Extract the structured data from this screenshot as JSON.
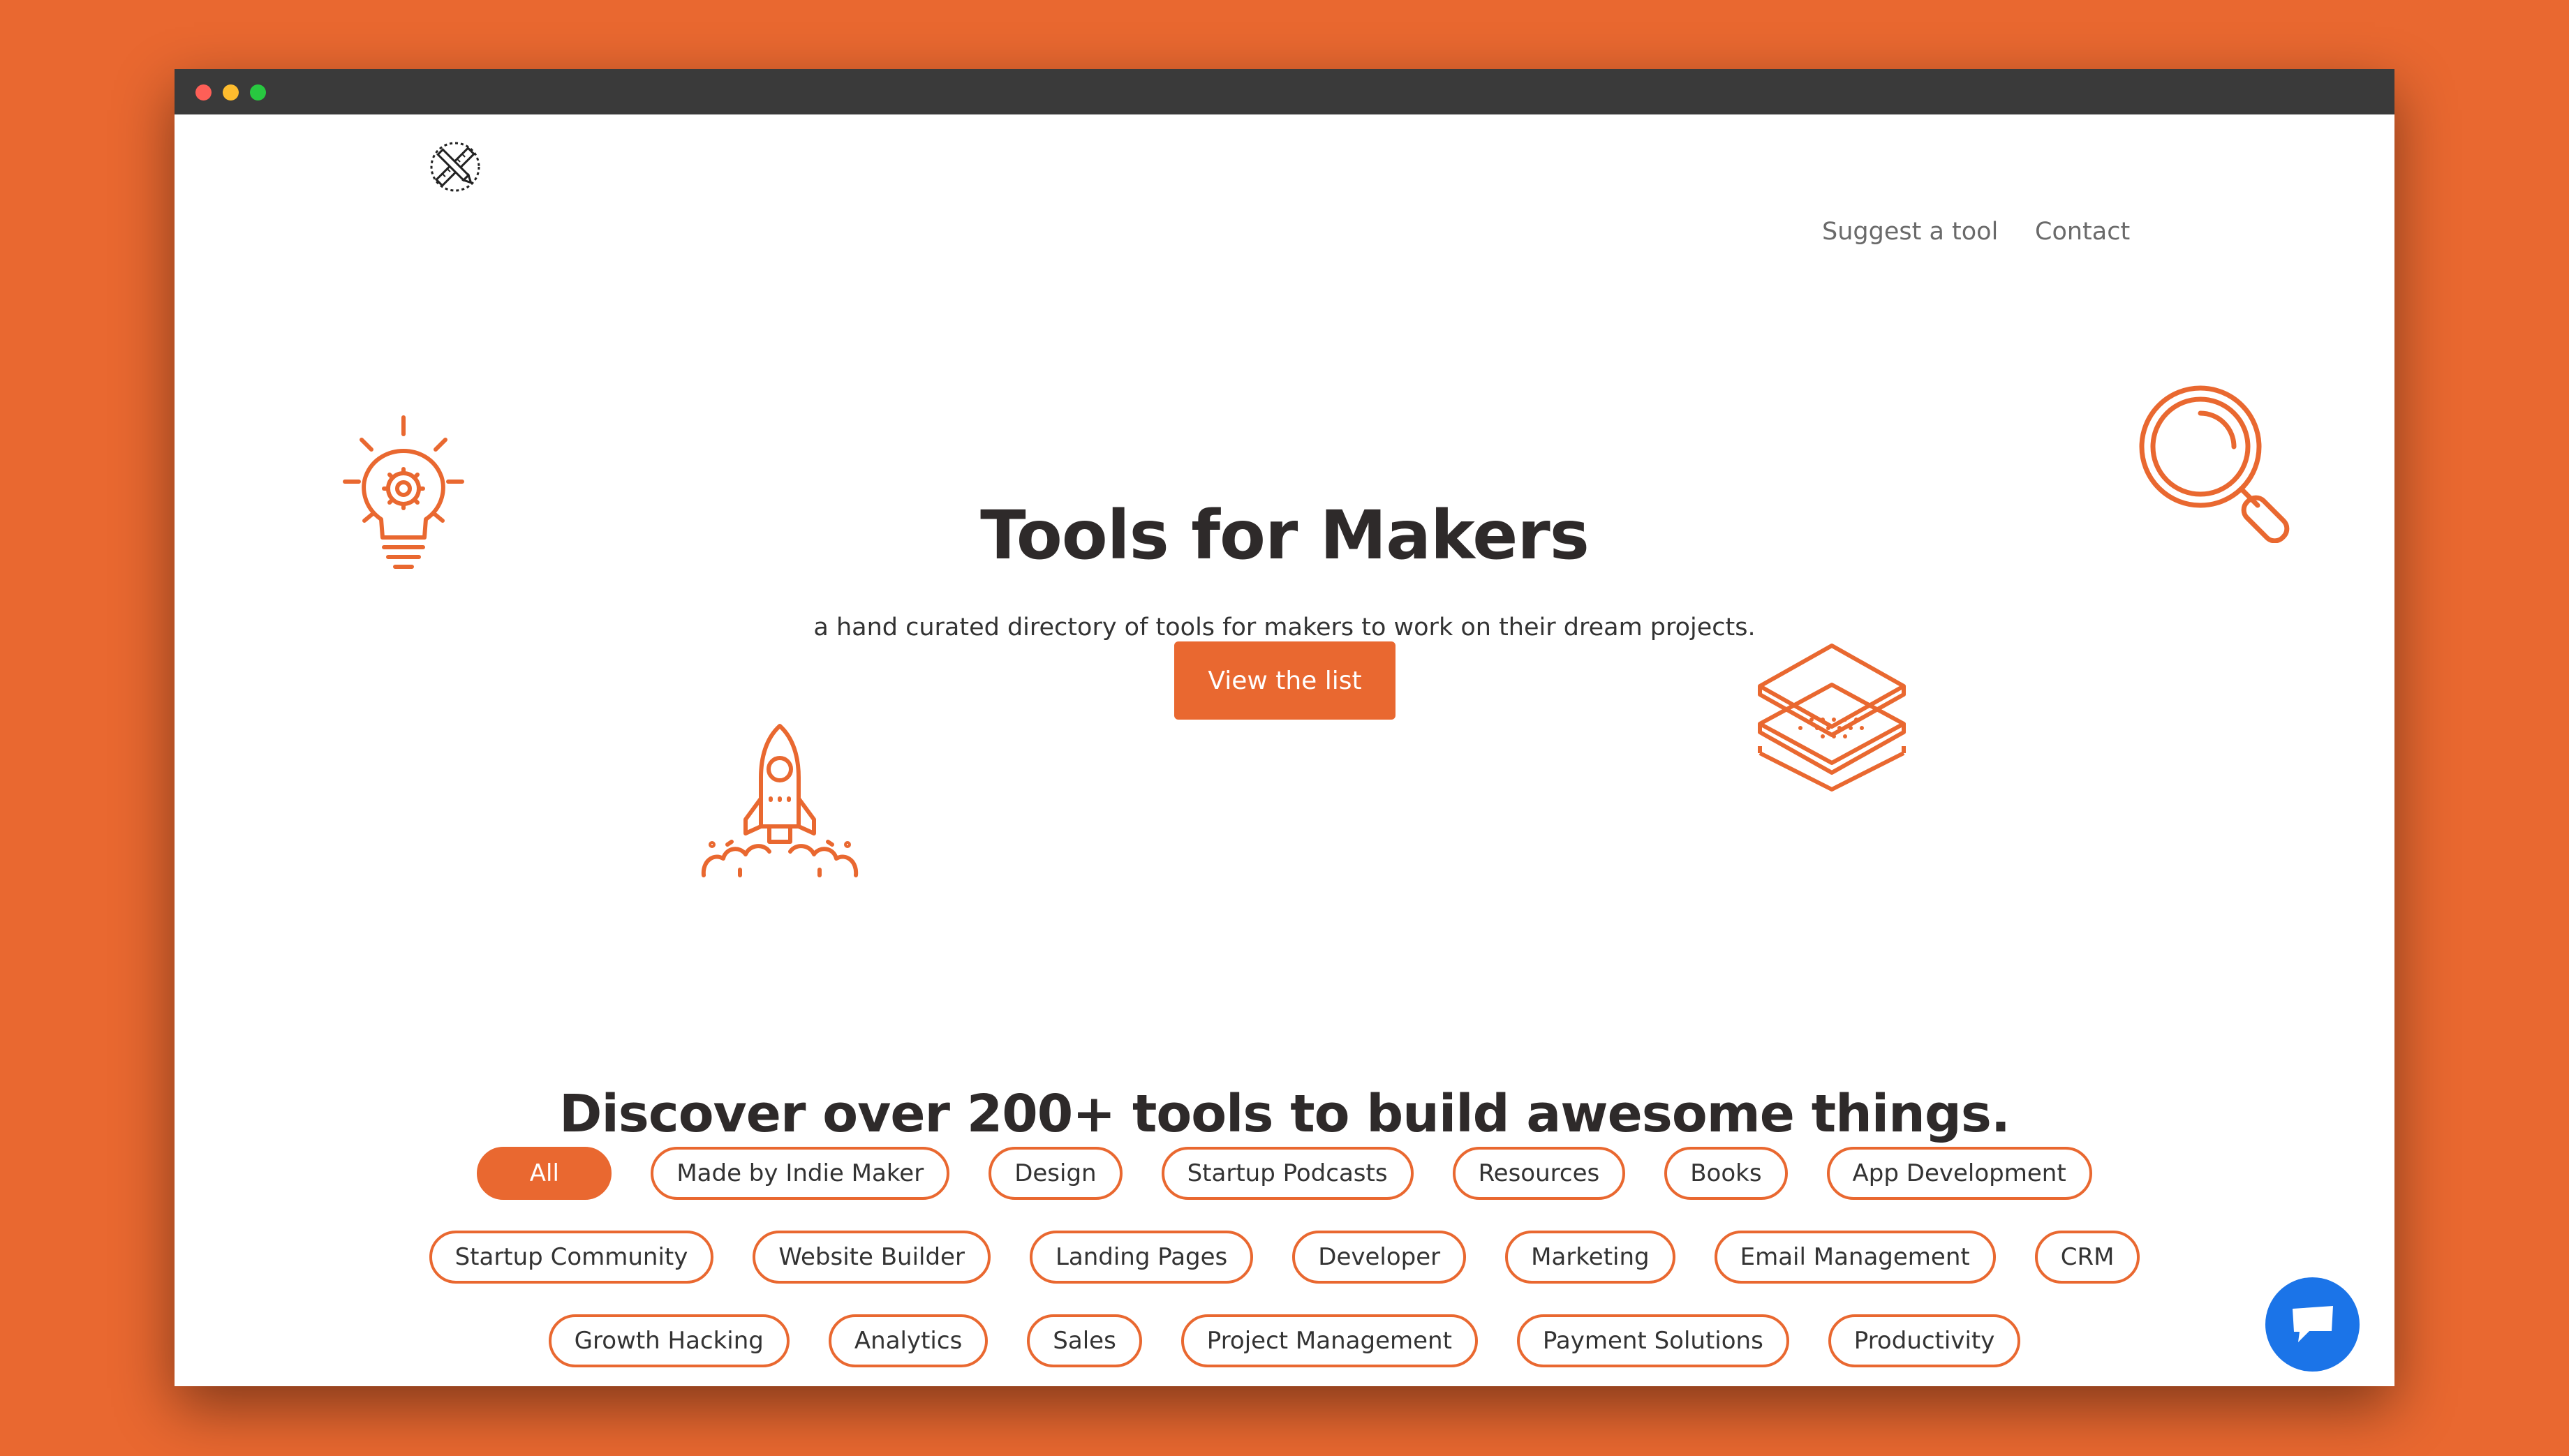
{
  "window": {
    "controls": [
      "close",
      "minimize",
      "maximize"
    ]
  },
  "header": {
    "logo_icon": "crossed-pencil-ruler-icon",
    "nav": [
      {
        "label": "Suggest a tool"
      },
      {
        "label": "Contact"
      }
    ]
  },
  "hero": {
    "title": "Tools for Makers",
    "subtitle": "a hand curated directory of tools for makers to work on their dream projects.",
    "cta_label": "View the list",
    "illustrations": [
      "lightbulb-gear-icon",
      "rocket-icon",
      "layers-icon",
      "magnifier-icon"
    ]
  },
  "discover": {
    "heading": "Discover over 200+ tools to build awesome things.",
    "active_tag": "All",
    "tags_row1": [
      "All",
      "Made by Indie Maker",
      "Design",
      "Startup Podcasts",
      "Resources",
      "Books",
      "App Development"
    ],
    "tags_row2": [
      "Startup Community",
      "Website Builder",
      "Landing Pages",
      "Developer",
      "Marketing",
      "Email Management",
      "CRM"
    ],
    "tags_row3": [
      "Growth Hacking",
      "Analytics",
      "Sales",
      "Project Management",
      "Payment Solutions",
      "Productivity"
    ]
  },
  "chat": {
    "icon": "chat-bubble-icon"
  },
  "colors": {
    "accent": "#e96830",
    "titlebar": "#3a3a3a",
    "heading_text": "#2e2a2a",
    "chat_button": "#1b74e8"
  }
}
